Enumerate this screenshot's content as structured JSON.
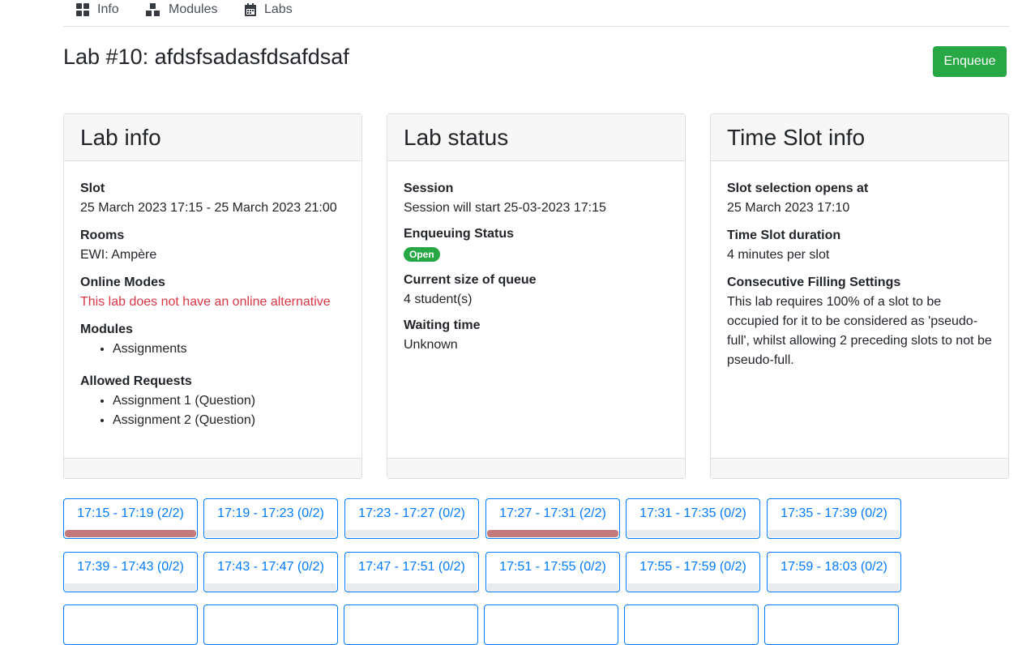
{
  "nav": {
    "items": [
      {
        "label": "Info",
        "icon": "grid-icon"
      },
      {
        "label": "Modules",
        "icon": "cubes-icon"
      },
      {
        "label": "Labs",
        "icon": "calendar-icon"
      }
    ]
  },
  "page": {
    "title": "Lab #10: afdsfsadasfdsafdsaf",
    "enqueue_label": "Enqueue"
  },
  "lab_info": {
    "title": "Lab info",
    "slot_label": "Slot",
    "slot_value": "25 March 2023 17:15 - 25 March 2023 21:00",
    "rooms_label": "Rooms",
    "rooms_value": "EWI: Ampère",
    "online_label": "Online Modes",
    "online_value": "This lab does not have an online alternative",
    "modules_label": "Modules",
    "modules": [
      "Assignments"
    ],
    "requests_label": "Allowed Requests",
    "requests": [
      "Assignment 1 (Question)",
      "Assignment 2 (Question)"
    ]
  },
  "lab_status": {
    "title": "Lab status",
    "session_label": "Session",
    "session_value": "Session will start 25-03-2023 17:15",
    "enqueuing_label": "Enqueuing Status",
    "enqueuing_badge": "Open",
    "queue_label": "Current size of queue",
    "queue_value": "4 student(s)",
    "waiting_label": "Waiting time",
    "waiting_value": "Unknown"
  },
  "time_slot_info": {
    "title": "Time Slot info",
    "opens_label": "Slot selection opens at",
    "opens_value": "25 March 2023 17:10",
    "duration_label": "Time Slot duration",
    "duration_value": "4 minutes per slot",
    "consecutive_label": "Consecutive Filling Settings",
    "consecutive_value": "This lab requires 100% of a slot to be occupied for it to be considered as 'pseudo-full', whilst allowing 2 preceding slots to not be pseudo-full."
  },
  "slots": [
    {
      "label": "17:15 - 17:19 (2/2)",
      "fill": 1.0
    },
    {
      "label": "17:19 - 17:23 (0/2)",
      "fill": 0
    },
    {
      "label": "17:23 - 17:27 (0/2)",
      "fill": 0
    },
    {
      "label": "17:27 - 17:31 (2/2)",
      "fill": 1.0
    },
    {
      "label": "17:31 - 17:35 (0/2)",
      "fill": 0
    },
    {
      "label": "17:35 - 17:39 (0/2)",
      "fill": 0
    },
    {
      "label": "17:39 - 17:43 (0/2)",
      "fill": 0
    },
    {
      "label": "17:43 - 17:47 (0/2)",
      "fill": 0
    },
    {
      "label": "17:47 - 17:51 (0/2)",
      "fill": 0
    },
    {
      "label": "17:51 - 17:55 (0/2)",
      "fill": 0
    },
    {
      "label": "17:55 - 17:59 (0/2)",
      "fill": 0
    },
    {
      "label": "17:59 - 18:03 (0/2)",
      "fill": 0
    }
  ],
  "colors": {
    "accent": "#007bff",
    "success": "#28a745",
    "danger": "#dc3545",
    "slot_full": "#c47a7c"
  }
}
